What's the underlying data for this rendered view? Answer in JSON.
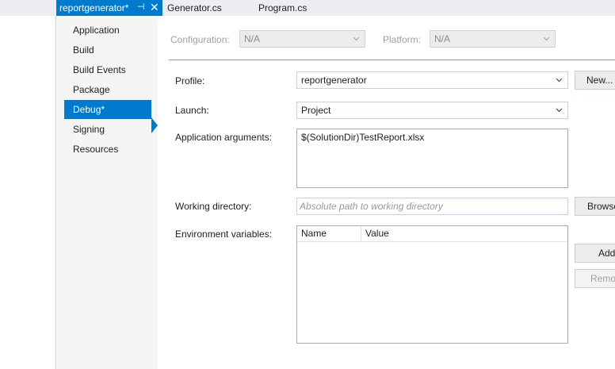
{
  "tabs": {
    "active_label": "reportgenerator*",
    "pin_glyph": "⊣",
    "close_glyph": "✕",
    "items": [
      "Generator.cs",
      "Program.cs"
    ]
  },
  "nav": {
    "items": [
      "Application",
      "Build",
      "Build Events",
      "Package",
      "Debug*",
      "Signing",
      "Resources"
    ],
    "selected_index": 4
  },
  "topbar": {
    "configuration_label": "Configuration:",
    "configuration_value": "N/A",
    "platform_label": "Platform:",
    "platform_value": "N/A"
  },
  "form": {
    "profile_label": "Profile:",
    "profile_value": "reportgenerator",
    "new_button": "New...",
    "launch_label": "Launch:",
    "launch_value": "Project",
    "args_label": "Application arguments:",
    "args_value": "$(SolutionDir)TestReport.xlsx",
    "workdir_label": "Working directory:",
    "workdir_placeholder": "Absolute path to working directory",
    "browse_button": "Browse...",
    "env_label": "Environment variables:",
    "env_columns": [
      "Name",
      "Value"
    ],
    "add_button": "Add",
    "remove_button": "Remove"
  },
  "colors": {
    "accent": "#007acc",
    "tabstrip": "#eeeef2",
    "nav_bg": "#f5f5f5"
  },
  "icons": {
    "combo_chevron": "chevron-down-icon",
    "tab_pin": "pin-icon",
    "tab_close": "close-icon"
  }
}
